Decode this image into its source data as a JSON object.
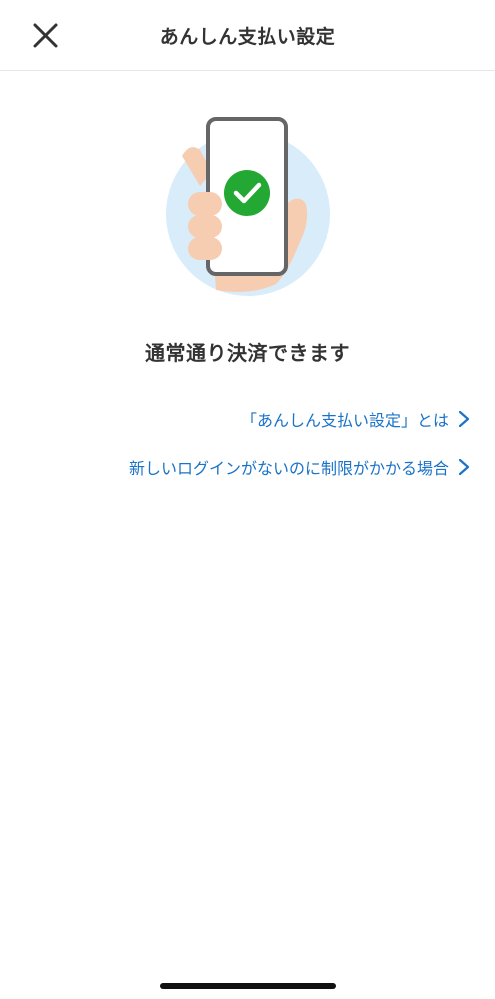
{
  "header": {
    "title": "あんしん支払い設定",
    "close_icon": "close-icon"
  },
  "main": {
    "illustration": "phone-in-hand-with-checkmark",
    "status_message": "通常通り決済できます",
    "links": [
      {
        "label": "「あんしん支払い設定」とは",
        "icon": "chevron-right-icon"
      },
      {
        "label": "新しいログインがないのに制限がかかる場合",
        "icon": "chevron-right-icon"
      }
    ]
  },
  "colors": {
    "link": "#1a73c8",
    "check_circle": "#22a833",
    "circle_bg": "#d8ecfa",
    "skin": "#f7cdb2",
    "phone_frame": "#666666"
  }
}
